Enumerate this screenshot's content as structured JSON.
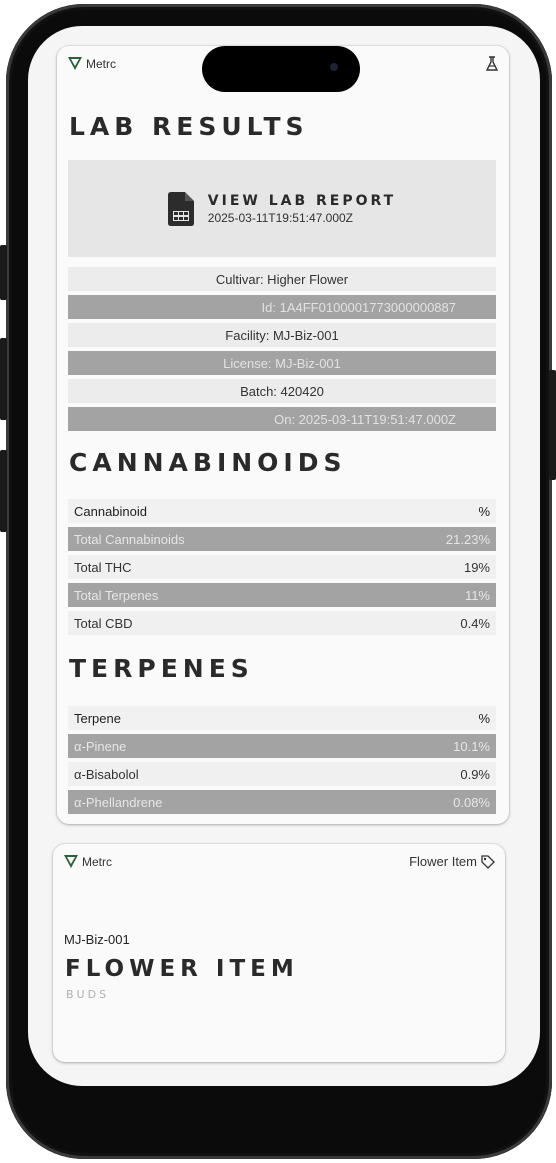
{
  "card1": {
    "brand": "Metrc",
    "header_icon": "flask-icon",
    "title": "LAB RESULTS",
    "report": {
      "label": "VIEW LAB REPORT",
      "date": "2025-03-11T19:51:47.000Z",
      "icon": "spreadsheet-file-icon"
    },
    "info": [
      "Cultivar: Higher Flower",
      "Id: 1A4FF0100001773000000887",
      "Facility: MJ-Biz-001",
      "License: MJ-Biz-001",
      "Batch: 420420",
      "On: 2025-03-11T19:51:47.000Z"
    ],
    "cannabinoids": {
      "title": "CANNABINOIDS",
      "header": [
        "Cannabinoid",
        "%"
      ],
      "rows": [
        [
          "Total Cannabinoids",
          "21.23%"
        ],
        [
          "Total THC",
          "19%"
        ],
        [
          "Total Terpenes",
          "11%"
        ],
        [
          "Total CBD",
          "0.4%"
        ]
      ]
    },
    "terpenes": {
      "title": "TERPENES",
      "header": [
        "Terpene",
        "%"
      ],
      "rows": [
        [
          "α-Pinene",
          "10.1%"
        ],
        [
          "α-Bisabolol",
          "0.9%"
        ],
        [
          "α-Phellandrene",
          "0.08%"
        ]
      ]
    }
  },
  "card2": {
    "brand": "Metrc",
    "tag_label": "Flower Item",
    "tag_icon": "tag-icon",
    "facility": "MJ-Biz-001",
    "title": "FLOWER ITEM",
    "subtitle": "BUDS"
  },
  "colors": {
    "dark_row": "#a3a3a3",
    "light_row": "#ececec",
    "report_bg": "#e6e6e6",
    "brand_green": "#2f5e3a"
  }
}
